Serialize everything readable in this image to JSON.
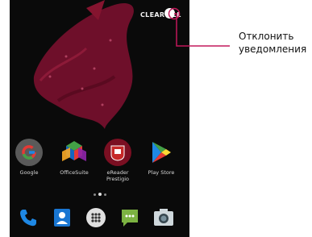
{
  "notification": {
    "clear_all": "CLEAR ALL"
  },
  "apps": [
    {
      "label": "Google",
      "icon": "google-icon"
    },
    {
      "label": "OfficeSuite",
      "icon": "officesuite-icon"
    },
    {
      "label": "eReader\nPrestigio",
      "icon": "ereader-prestigio-icon"
    },
    {
      "label": "Play Store",
      "icon": "play-store-icon"
    }
  ],
  "dock": [
    {
      "icon": "phone-icon"
    },
    {
      "icon": "contacts-icon"
    },
    {
      "icon": "app-drawer-icon"
    },
    {
      "icon": "messages-icon"
    },
    {
      "icon": "camera-icon"
    }
  ],
  "annotation": {
    "line1": "Отклонить",
    "line2": "уведомления"
  },
  "colors": {
    "callout_line": "#c2185b",
    "wallpaper_stroke": "#6e0f2a"
  }
}
